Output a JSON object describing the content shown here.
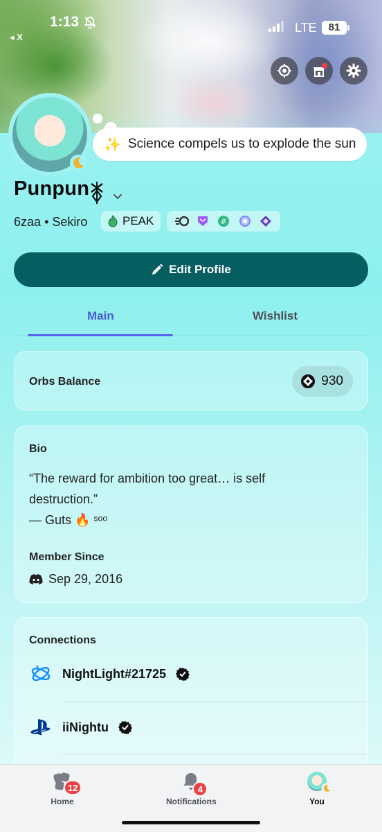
{
  "status_bar": {
    "time": "1:13",
    "back_label": "◂ X",
    "network": "LTE",
    "battery": "81"
  },
  "profile": {
    "display_name": "Punpun",
    "custom_status": "Science compels us to explode the sun",
    "username": "6zaa",
    "pronouns_or_game": "Sekiro",
    "guild_tag": "PEAK"
  },
  "actions": {
    "edit_profile": "Edit Profile"
  },
  "tabs": [
    {
      "label": "Main",
      "active": true
    },
    {
      "label": "Wishlist",
      "active": false
    }
  ],
  "orbs": {
    "label": "Orbs Balance",
    "value": "930"
  },
  "bio": {
    "heading": "Bio",
    "text_line1": "“The reward for ambition too great… is self",
    "text_line2": "destruction.”",
    "text_line3": "— Guts 🔥 ˢᵒᵒ"
  },
  "member_since": {
    "heading": "Member Since",
    "date": "Sep 29, 2016"
  },
  "connections": {
    "heading": "Connections",
    "items": [
      {
        "service": "battle-net",
        "account": "NightLight#21725",
        "verified": true
      },
      {
        "service": "playstation",
        "account": "iiNightu",
        "verified": true
      }
    ]
  },
  "bottom_nav": {
    "home": {
      "label": "Home",
      "badge": "12"
    },
    "notifications": {
      "label": "Notifications",
      "badge": "4"
    },
    "you": {
      "label": "You"
    }
  },
  "colors": {
    "accent": "#5865f2",
    "edit_button": "#075e61",
    "badge_red": "#ed4245",
    "background_top": "#9ff2f2"
  }
}
